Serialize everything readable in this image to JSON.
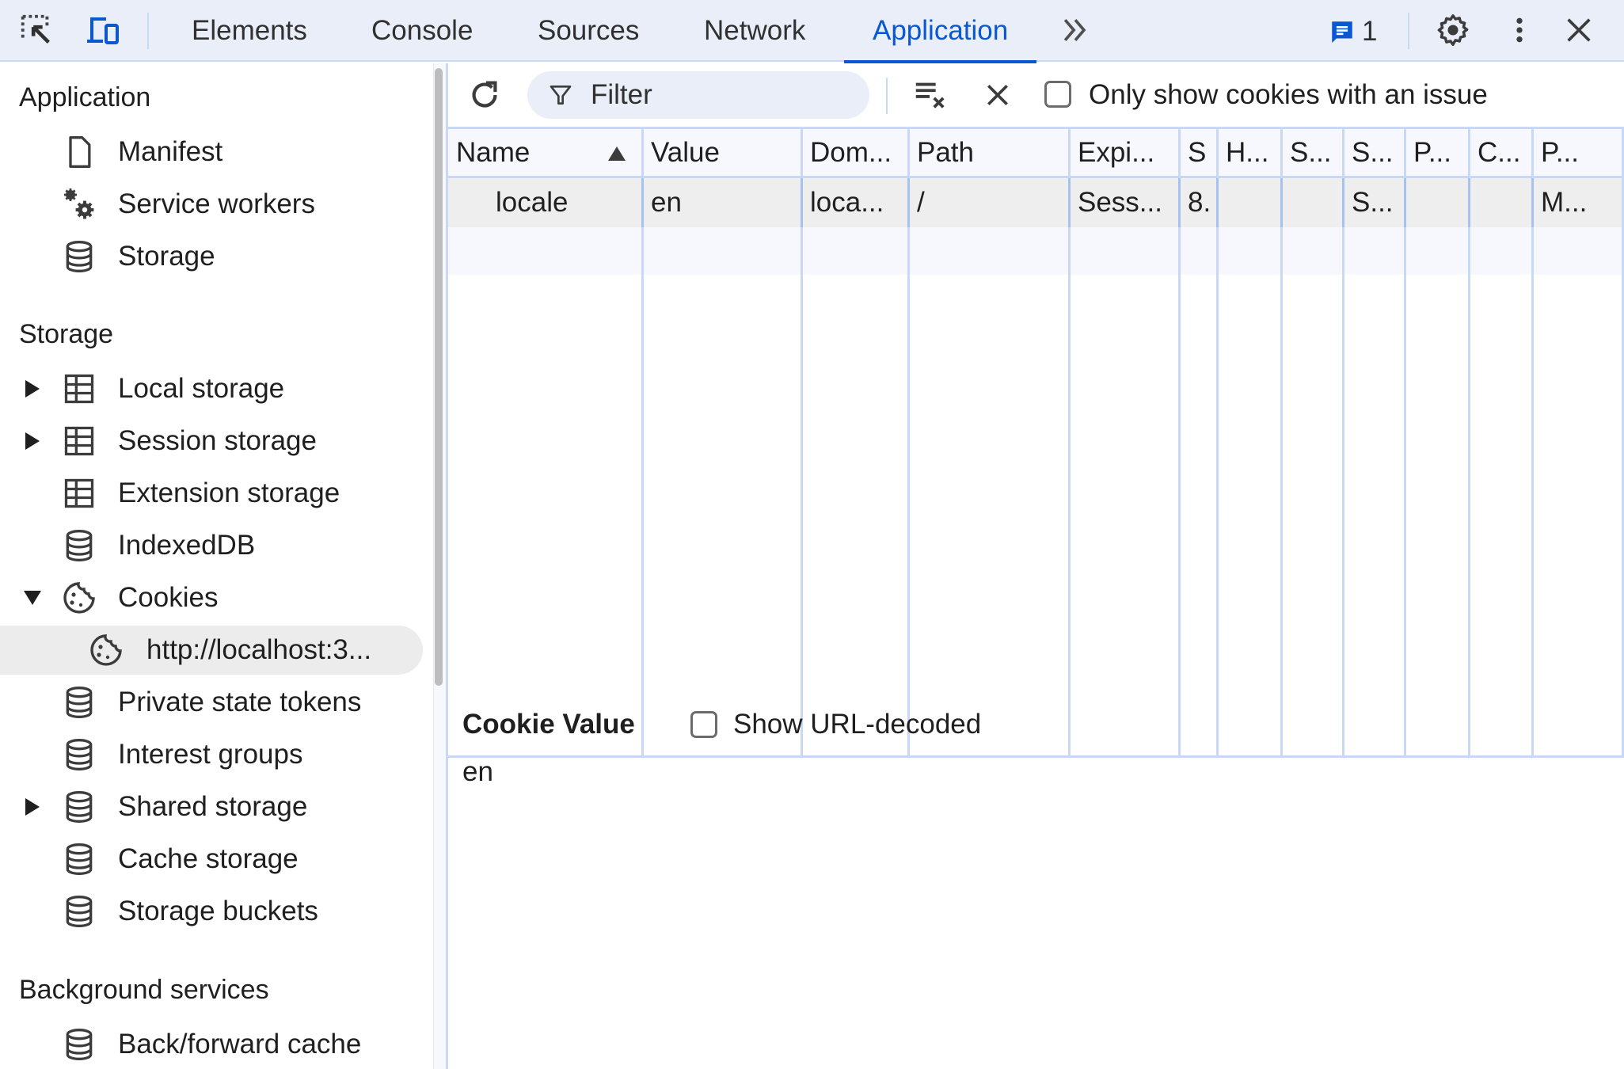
{
  "topbar": {
    "tabs": [
      {
        "label": "Elements",
        "active": false
      },
      {
        "label": "Console",
        "active": false
      },
      {
        "label": "Sources",
        "active": false
      },
      {
        "label": "Network",
        "active": false
      },
      {
        "label": "Application",
        "active": true
      }
    ],
    "more_tabs_icon": "chevron-double-right-icon",
    "issues_count": "1",
    "accent_color": "#0b57d0"
  },
  "sidebar": {
    "sections": [
      {
        "heading": "Application",
        "items": [
          {
            "label": "Manifest",
            "icon": "document-icon"
          },
          {
            "label": "Service workers",
            "icon": "gears-icon"
          },
          {
            "label": "Storage",
            "icon": "database-icon"
          }
        ]
      },
      {
        "heading": "Storage",
        "items": [
          {
            "label": "Local storage",
            "icon": "table-icon",
            "expandable": true,
            "expanded": false
          },
          {
            "label": "Session storage",
            "icon": "table-icon",
            "expandable": true,
            "expanded": false
          },
          {
            "label": "Extension storage",
            "icon": "table-icon"
          },
          {
            "label": "IndexedDB",
            "icon": "database-icon"
          },
          {
            "label": "Cookies",
            "icon": "cookie-icon",
            "expandable": true,
            "expanded": true
          },
          {
            "label": "http://localhost:3...",
            "icon": "cookie-icon",
            "child": true,
            "selected": true
          },
          {
            "label": "Private state tokens",
            "icon": "database-icon"
          },
          {
            "label": "Interest groups",
            "icon": "database-icon"
          },
          {
            "label": "Shared storage",
            "icon": "database-icon",
            "expandable": true,
            "expanded": false
          },
          {
            "label": "Cache storage",
            "icon": "database-icon"
          },
          {
            "label": "Storage buckets",
            "icon": "database-icon"
          }
        ]
      },
      {
        "heading": "Background services",
        "items": [
          {
            "label": "Back/forward cache",
            "icon": "database-icon"
          }
        ]
      }
    ]
  },
  "toolbar": {
    "filter_placeholder": "Filter",
    "filter_value": "",
    "only_issues_label": "Only show cookies with an issue",
    "only_issues_checked": false
  },
  "table": {
    "columns": [
      "Name",
      "Value",
      "Dom...",
      "Path",
      "Expi...",
      "S",
      "H...",
      "S...",
      "S...",
      "P...",
      "C...",
      "P..."
    ],
    "sort_column": "Name",
    "sort_direction": "ascending",
    "rows": [
      [
        "locale",
        "en",
        "loca...",
        "/",
        "Sess...",
        "8.",
        "",
        "",
        "S...",
        "",
        "",
        "M..."
      ]
    ]
  },
  "cookie_value": {
    "title": "Cookie Value",
    "show_decoded_label": "Show URL-decoded",
    "show_decoded_checked": false,
    "value": "en"
  }
}
